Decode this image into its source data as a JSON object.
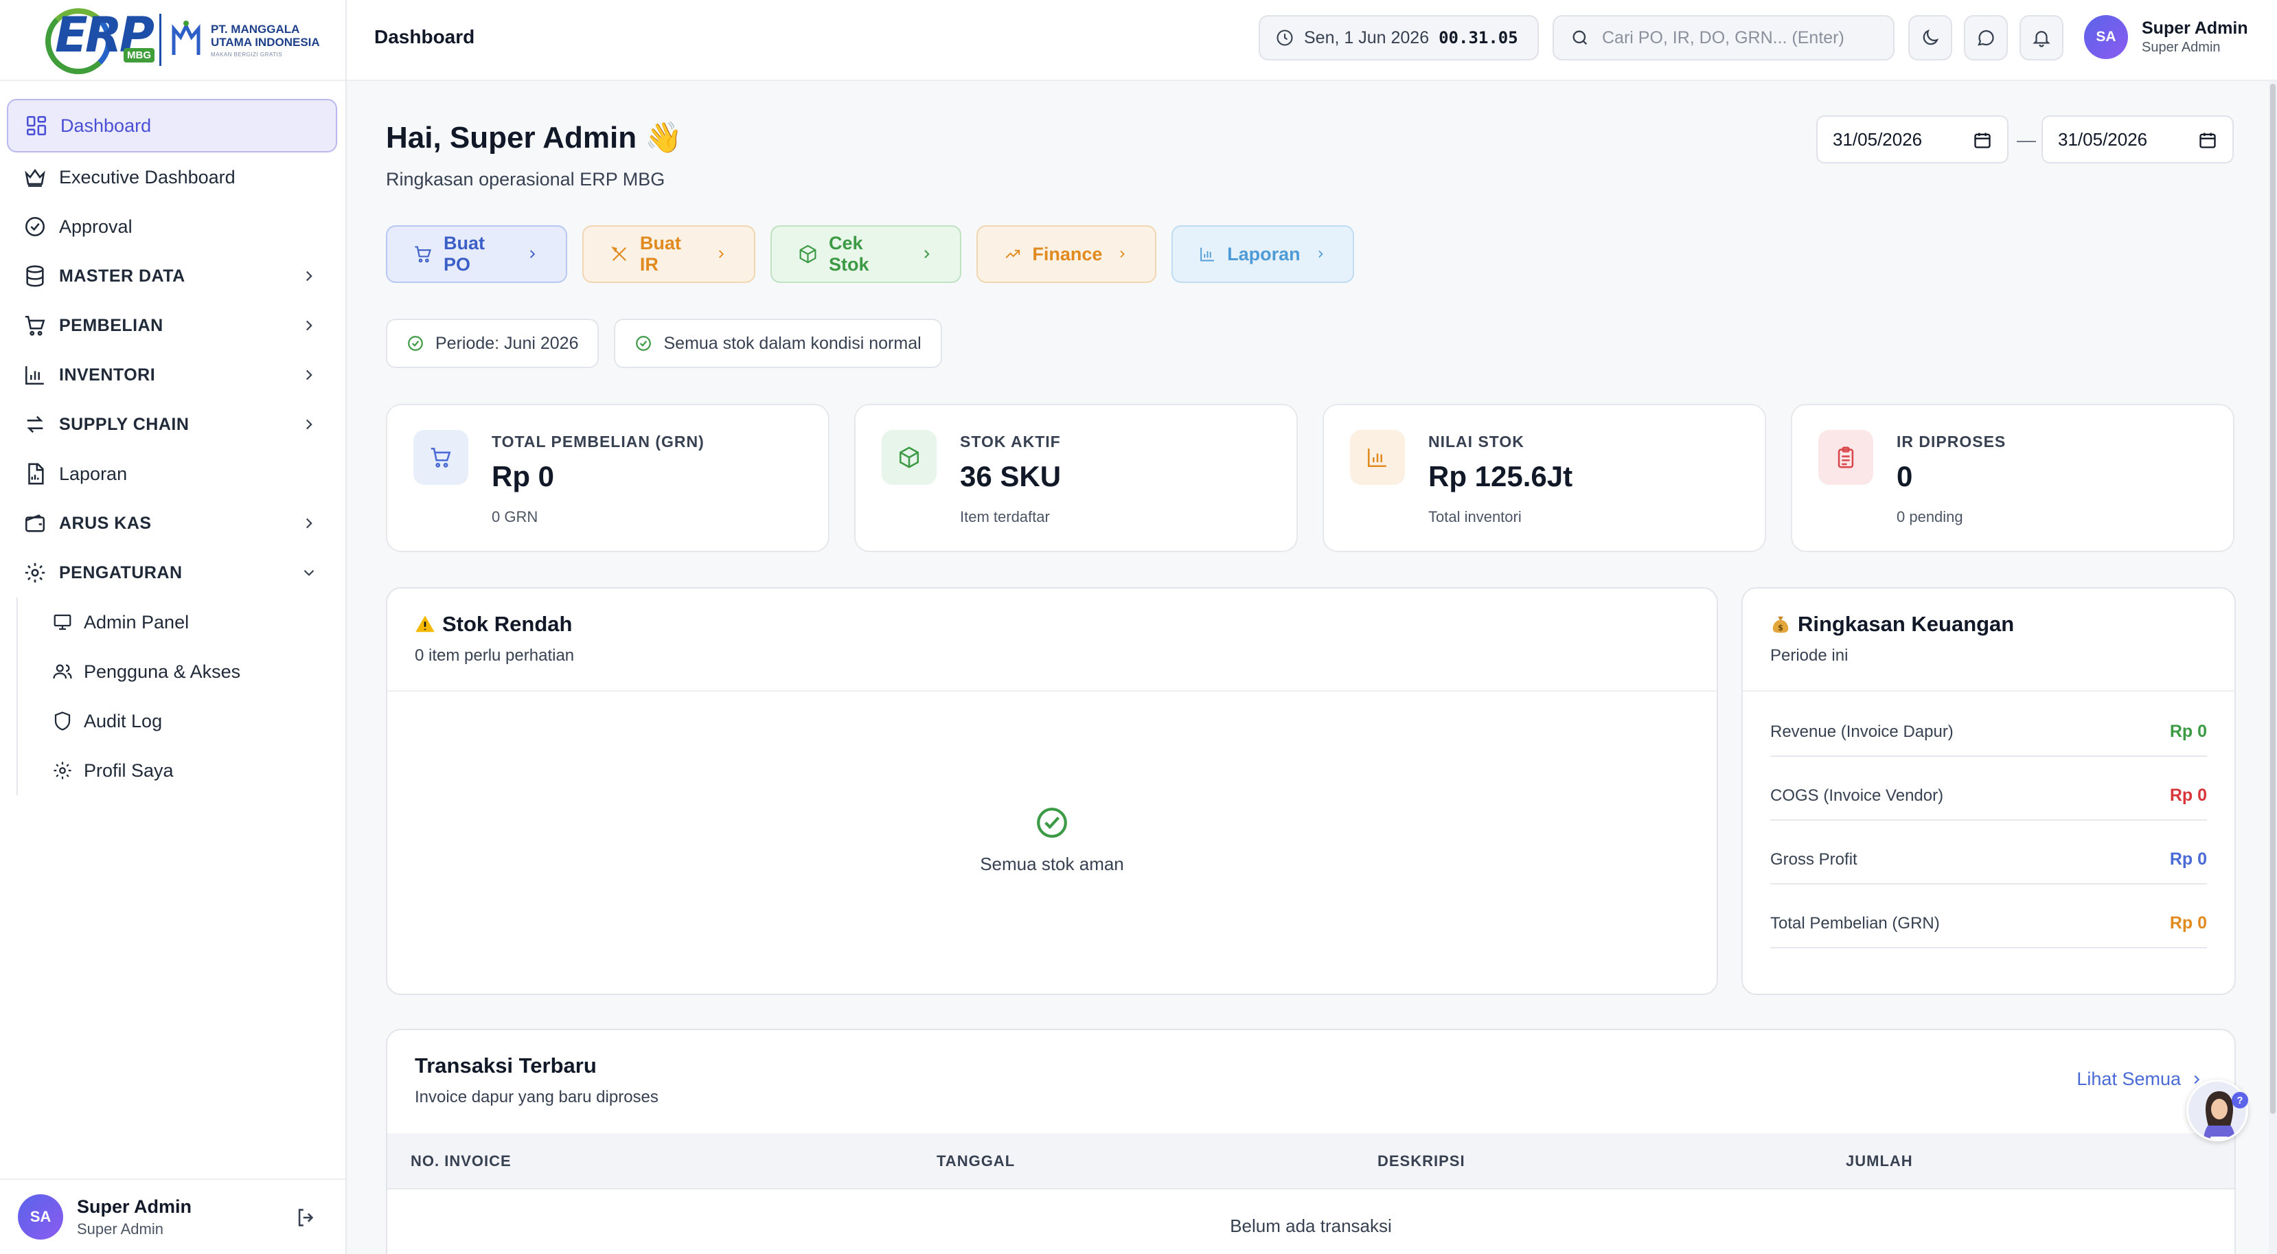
{
  "brand": {
    "logo_text": "ERP",
    "logo_sub": "MBG",
    "company_line1": "PT. MANGGALA",
    "company_line2": "UTAMA INDONESIA",
    "company_tagline": "MAKAN BERGIZI GRATIS"
  },
  "sidebar": {
    "items": [
      {
        "label": "Dashboard",
        "icon": "dashboard-icon",
        "active": true
      },
      {
        "label": "Executive Dashboard",
        "icon": "crown-icon"
      },
      {
        "label": "Approval",
        "icon": "check-circle-icon"
      },
      {
        "label": "MASTER DATA",
        "icon": "database-icon",
        "group": true
      },
      {
        "label": "PEMBELIAN",
        "icon": "cart-icon",
        "group": true
      },
      {
        "label": "INVENTORI",
        "icon": "bar-chart-icon",
        "group": true
      },
      {
        "label": "SUPPLY CHAIN",
        "icon": "swap-icon",
        "group": true
      },
      {
        "label": "Laporan",
        "icon": "report-icon"
      },
      {
        "label": "ARUS KAS",
        "icon": "wallet-icon",
        "group": true
      },
      {
        "label": "PENGATURAN",
        "icon": "gear-icon",
        "group": true,
        "expanded": true
      }
    ],
    "sub_items": [
      {
        "label": "Admin Panel",
        "icon": "monitor-icon"
      },
      {
        "label": "Pengguna & Akses",
        "icon": "users-icon"
      },
      {
        "label": "Audit Log",
        "icon": "shield-icon"
      },
      {
        "label": "Profil Saya",
        "icon": "gear-icon"
      }
    ],
    "user": {
      "initials": "SA",
      "name": "Super Admin",
      "role": "Super Admin"
    }
  },
  "topbar": {
    "title": "Dashboard",
    "date": "Sen, 1 Jun 2026",
    "time": "00.31.05",
    "search_placeholder": "Cari PO, IR, DO, GRN... (Enter)",
    "user": {
      "initials": "SA",
      "name": "Super Admin",
      "role": "Super Admin"
    }
  },
  "main": {
    "greeting": "Hai, Super Admin 👋",
    "subtitle": "Ringkasan operasional ERP MBG",
    "date_from": "31/05/2026",
    "date_to": "31/05/2026",
    "date_separator": "—",
    "quick_actions": [
      {
        "label": "Buat PO",
        "icon": "cart-icon"
      },
      {
        "label": "Buat IR",
        "icon": "utensils-icon"
      },
      {
        "label": "Cek Stok",
        "icon": "box-icon"
      },
      {
        "label": "Finance",
        "icon": "trend-up-icon"
      },
      {
        "label": "Laporan",
        "icon": "bar-chart-icon"
      }
    ],
    "pills": [
      {
        "label": "Periode: Juni 2026"
      },
      {
        "label": "Semua stok dalam kondisi normal"
      }
    ],
    "stats": [
      {
        "label": "TOTAL PEMBELIAN (GRN)",
        "value": "Rp 0",
        "sub": "0 GRN",
        "icon": "cart-icon",
        "color": "#4a6ad6",
        "bg": "#e9eefb"
      },
      {
        "label": "STOK AKTIF",
        "value": "36 SKU",
        "sub": "Item terdaftar",
        "icon": "box-icon",
        "color": "#3c9a45",
        "bg": "#e8f5ea"
      },
      {
        "label": "NILAI STOK",
        "value": "Rp 125.6Jt",
        "sub": "Total inventori",
        "icon": "bar-chart-icon",
        "color": "#e08a1f",
        "bg": "#fbf0e2"
      },
      {
        "label": "IR DIPROSES",
        "value": "0",
        "sub": "0 pending",
        "icon": "clipboard-icon",
        "color": "#d9464b",
        "bg": "#fbe7e8"
      }
    ],
    "low_stock": {
      "title": "Stok Rendah",
      "subtitle": "0 item perlu perhatian",
      "empty_text": "Semua stok aman"
    },
    "finance": {
      "title": "Ringkasan Keuangan",
      "subtitle": "Periode ini",
      "rows": [
        {
          "label": "Revenue (Invoice Dapur)",
          "value": "Rp 0",
          "color": "#3c9a45"
        },
        {
          "label": "COGS (Invoice Vendor)",
          "value": "Rp 0",
          "color": "#d9363b"
        },
        {
          "label": "Gross Profit",
          "value": "Rp 0",
          "color": "#4a6ad6"
        },
        {
          "label": "Total Pembelian (GRN)",
          "value": "Rp 0",
          "color": "#e08a1f"
        }
      ]
    },
    "transactions": {
      "title": "Transaksi Terbaru",
      "subtitle": "Invoice dapur yang baru diproses",
      "view_all": "Lihat Semua",
      "columns": [
        "NO. INVOICE",
        "TANGGAL",
        "DESKRIPSI",
        "JUMLAH"
      ],
      "empty_text": "Belum ada transaksi"
    },
    "helper_badge": "?"
  }
}
